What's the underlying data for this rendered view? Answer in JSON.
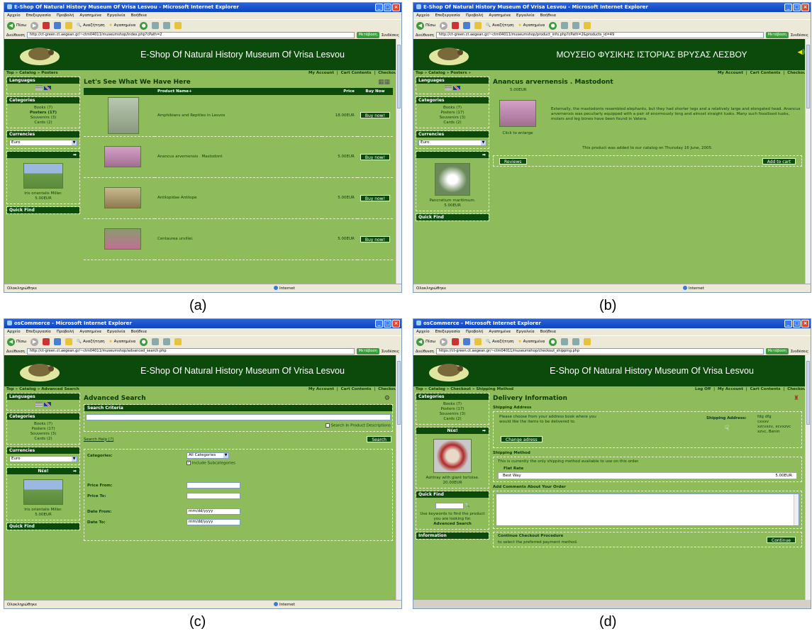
{
  "browser": {
    "app_suffix": "Microsoft Internet Explorer",
    "menu": [
      "Αρχείο",
      "Επεξεργασία",
      "Προβολή",
      "Αγαπημένα",
      "Εργαλεία",
      "Βοήθεια"
    ],
    "toolbar": {
      "back": "Πίσω",
      "search": "Αναζήτηση",
      "favorites": "Αγαπημένα"
    },
    "address_label": "Διεύθυνση",
    "go": "Μετάβαση",
    "links": "Συνδέσεις",
    "status_done": "Ολοκληρώθηκε",
    "status_zone": "Internet"
  },
  "shop": {
    "title_en": "E-Shop Of Natural History Museum Of Vrisa Lesvou",
    "title_gr": "ΜΟΥΣΕΙΟ ΦΥΣΙΚΗΣ ΙΣΤΟΡΙΑΣ ΒΡΥΣΑΣ ΛΕΣΒΟΥ",
    "nav_account": "My Account",
    "nav_cart": "Cart Contents",
    "nav_checkout": "Checkout",
    "nav_logoff": "Log Off",
    "box_languages": "Languages",
    "box_categories": "Categories",
    "box_currencies": "Currencies",
    "box_new": "Νέα!",
    "box_quick_find": "Quick Find",
    "box_information": "Information",
    "currency": "Euro",
    "categories": [
      "Books (7)",
      "Posters (17)",
      "Souvenirs (3)",
      "Cards (2)"
    ],
    "new_product_a": {
      "name": "Iris orientalis Miller.",
      "price": "5.00EUR"
    },
    "new_product_b": {
      "name": "Pancratium maritimum.",
      "price": "5.00EUR"
    },
    "new_product_d": {
      "name": "Ashtray with giant tortoise.",
      "price": "20.00EUR"
    }
  },
  "captions": [
    "(a)",
    "(b)",
    "(c)",
    "(d)"
  ],
  "shotA": {
    "window_title": "E-Shop Of Natural History Museum Of Vrisa Lesvou",
    "url": "http://ct-green.ct.aegean.gr/~ctm04011/museumshop/index.php?cPath=2",
    "breadcrumb": "Top » Catalog » Posters",
    "heading": "Let's See What We Have Here",
    "col_name": "Product Name+",
    "col_price": "Price",
    "col_buy": "Buy Now",
    "buy_label": "Buy now!",
    "products": [
      {
        "name": "Amphibians and Reptiles in Lesvos",
        "price": "18.00EUR"
      },
      {
        "name": "Anancus arvernensis . Mastodont",
        "price": "5.00EUR"
      },
      {
        "name": "Antilopidae Antilope",
        "price": "5.00EUR"
      },
      {
        "name": "Centaurea urvillei.",
        "price": "5.00EUR"
      }
    ]
  },
  "shotB": {
    "window_title": "E-Shop Of Natural History Museum Of Vrisa Lesvou",
    "url": "http://ct-green.ct.aegean.gr/~ctm04011/museumshop/product_info.php?cPath=2&products_id=49",
    "breadcrumb": "Top » Catalog » Posters »",
    "product_name": "Anancus arvernensis . Mastodont",
    "price": "5.00EUR",
    "description": "Externally, the mastodonts resembled elephants, but they had shorter legs and a relatively large and elongated head. Anancus arvernensis was peculiarly equipped with a pair of enormously long and almost straight tusks. Many such fossilised tusks, molars and leg bones have been found in Vatera.",
    "click_enlarge": "Click to enlarge",
    "added_on": "This product was added to our catalog on Thursday 16 June, 2005.",
    "reviews": "Reviews",
    "add_to_cart": "Add to cart"
  },
  "shotC": {
    "window_title": "osCommerce - Microsoft Internet Explorer",
    "url": "http://ct-green.ct.aegean.gr/~ctm04011/museumshop/advanced_search.php",
    "breadcrumb": "Top » Catalog » Advanced Search",
    "heading": "Advanced Search",
    "criteria": "Search Criteria",
    "search_desc": "Search In Product Descriptions",
    "search_help": "Search Help [?]",
    "search_btn": "Search",
    "categories_label": "Categories:",
    "all_categories": "All Categories",
    "include_sub": "Include Subcategories",
    "price_from": "Price From:",
    "price_to": "Price To:",
    "date_from": "Date From:",
    "date_to": "Date To:",
    "date_placeholder": "mm/dd/yyyy"
  },
  "shotD": {
    "window_title": "osCommerce - Microsoft Internet Explorer",
    "url": "https://ct-green.ct.aegean.gr/~ctm04011/museumshop/checkout_shipping.php",
    "breadcrumb": "Top » Catalog » Checkout » Shipping Method",
    "heading": "Delivery Information",
    "shipping_address_head": "Shipping Address",
    "address_text": "Please choose from your address book where you would like the items to be delivered to.",
    "change_address": "Change adress",
    "shipping_address_label": "Shipping Address:",
    "address_lines": [
      "fdg dfg",
      "cxxxv",
      "xzcvxzv, xcvxzvc",
      "xzvc, Benin"
    ],
    "method_head": "Shipping Method",
    "method_text": "This is currently the only shipping method available to use on this order.",
    "flat_rate": "Flat Rate",
    "best_way": "Best Way",
    "best_price": "5.00EUR",
    "comments_head": "Add Comments About Your Order",
    "continue_head": "Continue Checkout Procedure",
    "continue_text": "to select the preferred payment method.",
    "continue_btn": "Continue",
    "quick_find_text": "Use keywords to find the product you are looking for.",
    "advanced_search": "Advanced Search"
  }
}
